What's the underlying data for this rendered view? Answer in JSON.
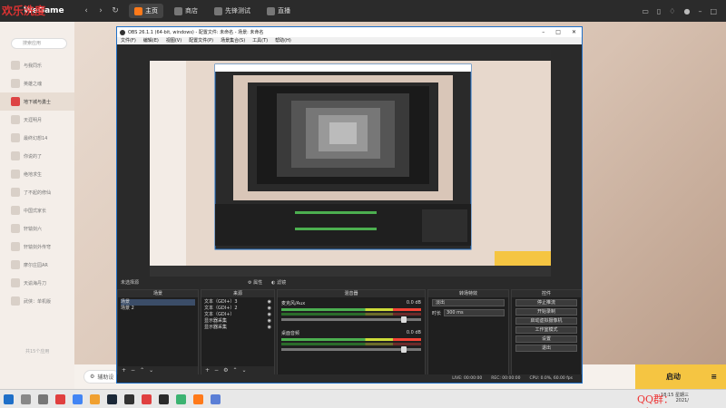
{
  "watermark": {
    "top_left": "欢乐洗度",
    "bottom_right": "QQ群：542886692"
  },
  "wegame": {
    "logo": "WeGame",
    "tabs": [
      {
        "label": "主页",
        "active": true
      },
      {
        "label": "商店",
        "active": false
      },
      {
        "label": "先锋测试",
        "active": false
      },
      {
        "label": "直播",
        "active": false
      }
    ],
    "search_placeholder": "搜索应用",
    "sidebar": [
      {
        "label": "与我同乐",
        "active": false
      },
      {
        "label": "英雄之魂",
        "active": false
      },
      {
        "label": "地下城与勇士",
        "active": true
      },
      {
        "label": "天涯明月",
        "active": false
      },
      {
        "label": "最终幻想14",
        "active": false
      },
      {
        "label": "你说的了",
        "active": false
      },
      {
        "label": "绝地求生",
        "active": false
      },
      {
        "label": "了不起的修仙",
        "active": false
      },
      {
        "label": "中国式家长",
        "active": false
      },
      {
        "label": "轩辕剑六",
        "active": false
      },
      {
        "label": "轩辕剑外传穹",
        "active": false
      },
      {
        "label": "摩尔庄园AR",
        "active": false
      },
      {
        "label": "天谕海丹刀",
        "active": false
      },
      {
        "label": "武侠：单机版",
        "active": false
      }
    ],
    "app_count": "共15个应用",
    "assist_label": "辅助设",
    "launch_label": "启动"
  },
  "obs": {
    "title": "OBS 26.1.1 (64-bit, windows) - 配置文件: 未命名 - 场景: 未命名",
    "menu": [
      "文件(F)",
      "编辑(E)",
      "视图(V)",
      "配置文件(P)",
      "场景集合(S)",
      "工具(T)",
      "帮助(H)"
    ],
    "no_source": "未选择源",
    "toolbar": {
      "properties": "属性",
      "filters": "滤镜"
    },
    "docks": {
      "scenes": {
        "title": "场景",
        "items": [
          "场景",
          "场景 2"
        ]
      },
      "sources": {
        "title": "来源",
        "items": [
          "文本（GDI+）3",
          "文本（GDI+）2",
          "文本（GDI+）",
          "显示器采集",
          "显示器采集"
        ]
      },
      "mixer": {
        "title": "混音器",
        "channels": [
          {
            "name": "麦克风/Aux",
            "db": "0.0 dB"
          },
          {
            "name": "桌面音频",
            "db": "0.0 dB"
          }
        ]
      },
      "transitions": {
        "title": "转场特效",
        "type": "淡出",
        "duration_label": "时长",
        "duration": "300 ms"
      },
      "controls": {
        "title": "控件",
        "buttons": [
          "停止推流",
          "开始录制",
          "启动虚拟摄像机",
          "工作室模式",
          "设置",
          "退出"
        ]
      }
    },
    "status": {
      "live": "LIVE: 00:00:00",
      "rec": "REC: 00:00:00",
      "cpu": "CPU: 0.0%, 60.00 fps"
    }
  },
  "taskbar": {
    "time": "18:15 星期三",
    "date": "2021/"
  }
}
